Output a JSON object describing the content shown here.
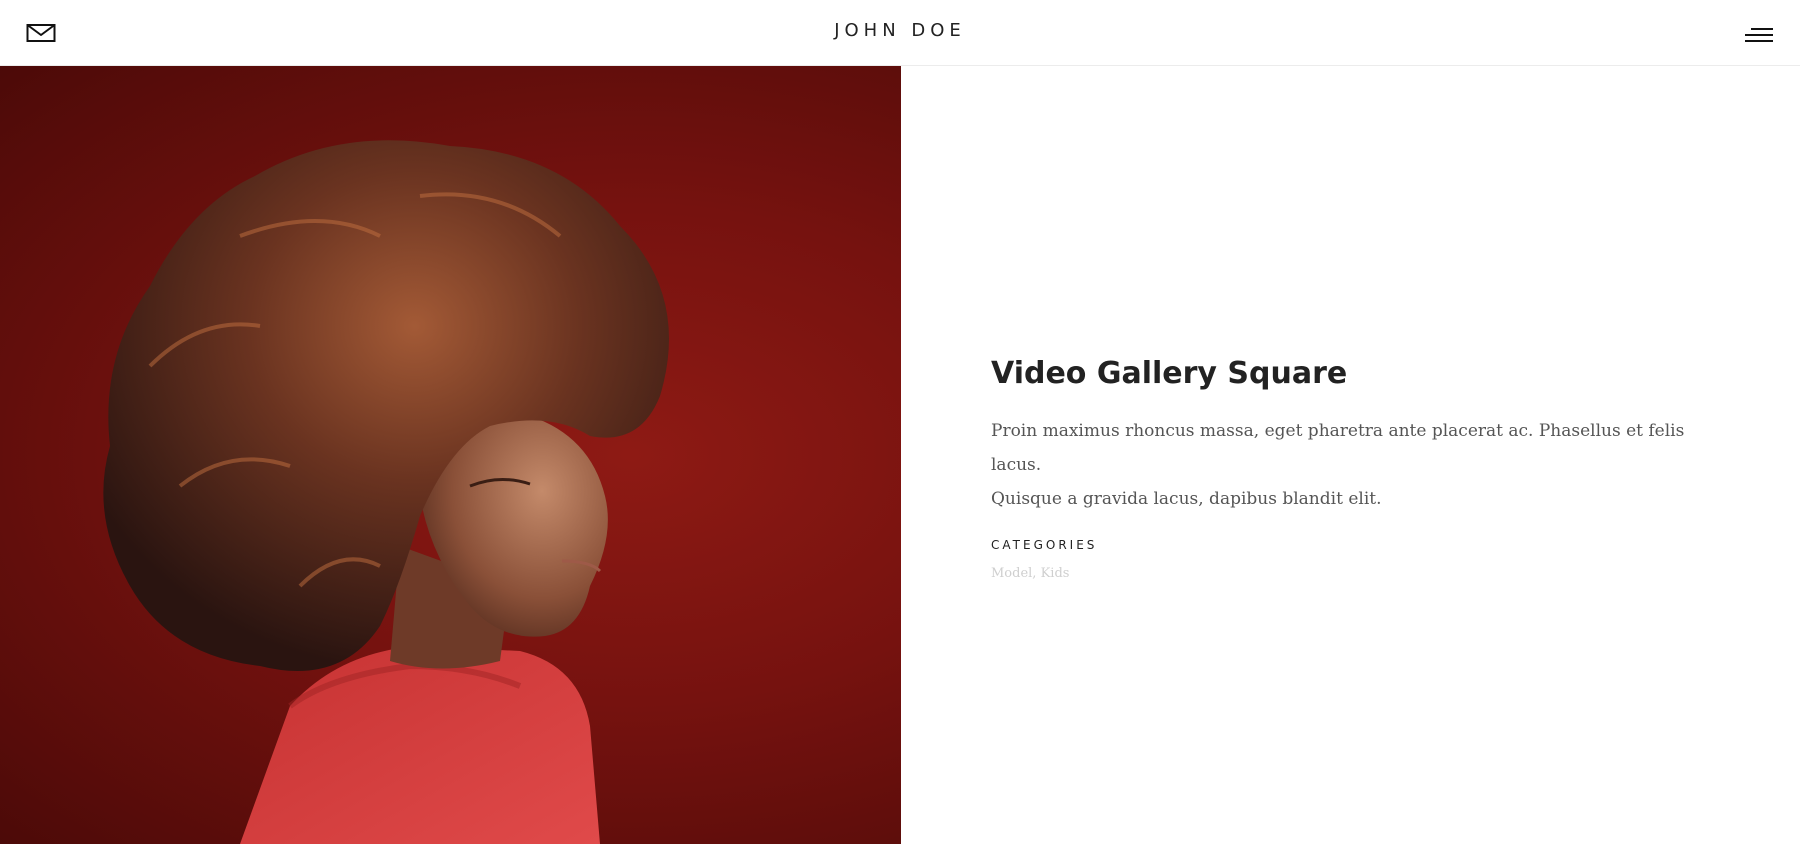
{
  "header": {
    "site_title": "JOHN DOE",
    "mail_icon": "envelope-icon",
    "menu_icon": "hamburger-menu-icon"
  },
  "hero": {
    "image": "portrait-photo",
    "background_color": "#7a130f"
  },
  "post": {
    "title": "Video Gallery Square",
    "description_line1": "Proin maximus rhoncus massa, eget pharetra ante placerat ac. Phasellus et felis lacus.",
    "description_line2": "Quisque a gravida lacus, dapibus blandit elit.",
    "categories_label": "CATEGORIES",
    "categories_value": "Model, Kids"
  },
  "colors": {
    "text_dark": "#222222",
    "text_body": "#555555",
    "text_muted": "#cfcfcf",
    "divider": "#ececec"
  }
}
